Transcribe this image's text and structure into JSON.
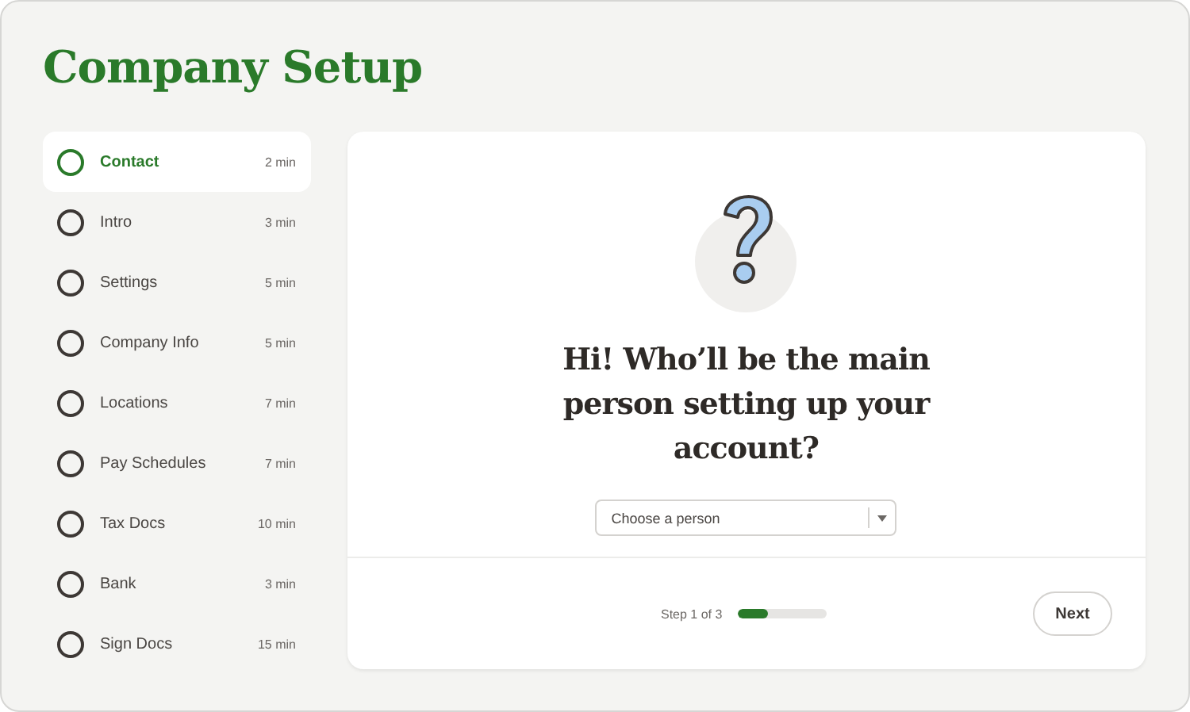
{
  "title": "Company Setup",
  "steps": [
    {
      "label": "Contact",
      "time": "2 min",
      "selected": true
    },
    {
      "label": "Intro",
      "time": "3 min",
      "selected": false
    },
    {
      "label": "Settings",
      "time": "5 min",
      "selected": false
    },
    {
      "label": "Company Info",
      "time": "5 min",
      "selected": false
    },
    {
      "label": "Locations",
      "time": "7 min",
      "selected": false
    },
    {
      "label": "Pay Schedules",
      "time": "7 min",
      "selected": false
    },
    {
      "label": "Tax Docs",
      "time": "10 min",
      "selected": false
    },
    {
      "label": "Bank",
      "time": "3 min",
      "selected": false
    },
    {
      "label": "Sign Docs",
      "time": "15 min",
      "selected": false
    }
  ],
  "question": "Hi! Who’ll be the main person setting up your account?",
  "select": {
    "placeholder": "Choose a person"
  },
  "progress": {
    "label": "Step 1 of 3",
    "level": 0.33
  },
  "next_button": "Next"
}
